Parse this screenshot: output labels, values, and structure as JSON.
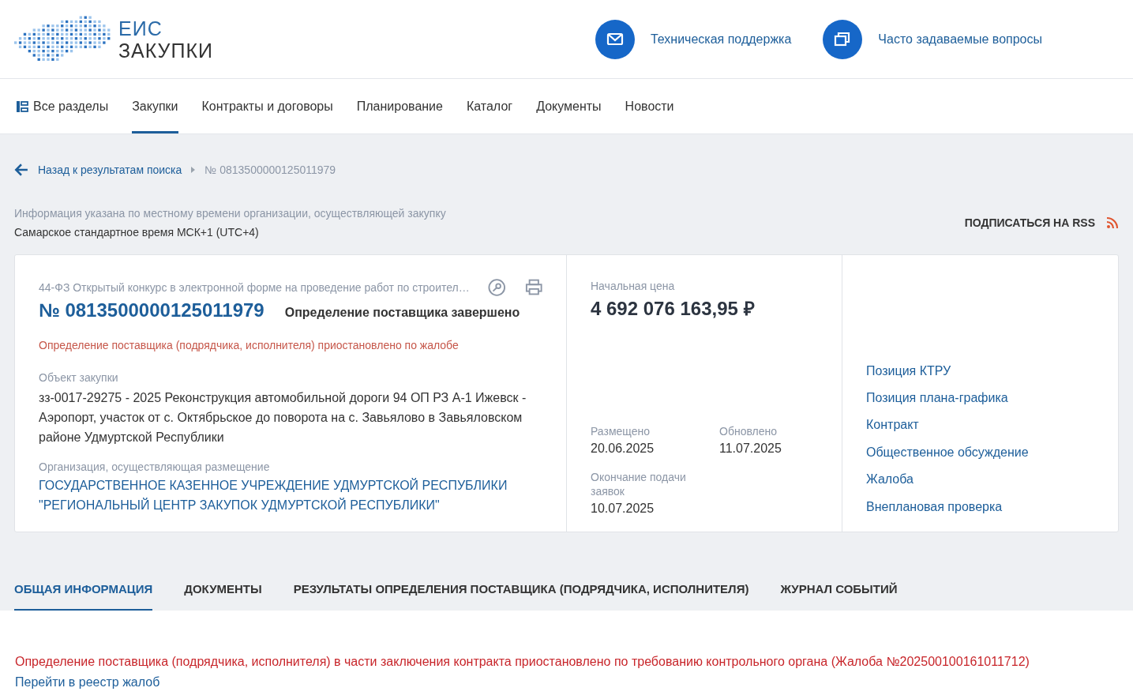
{
  "header": {
    "logo": {
      "line1": "ЕИС",
      "line2": "ЗАКУПКИ"
    },
    "links": [
      {
        "kind": "mail",
        "label": "Техническая поддержка"
      },
      {
        "kind": "windows",
        "label": "Часто задаваемые вопросы"
      }
    ]
  },
  "nav": [
    {
      "kind": "menu",
      "label": "Все разделы",
      "selected": false
    },
    {
      "kind": "link",
      "label": "Закупки",
      "selected": true
    },
    {
      "kind": "link",
      "label": "Контракты и договоры",
      "selected": false
    },
    {
      "kind": "link",
      "label": "Планирование",
      "selected": false
    },
    {
      "kind": "link",
      "label": "Каталог",
      "selected": false
    },
    {
      "kind": "link",
      "label": "Документы",
      "selected": false
    },
    {
      "kind": "link",
      "label": "Новости",
      "selected": false
    }
  ],
  "breadcrumb": {
    "back": "Назад к результатам поиска",
    "current": "№ 0813500000125011979"
  },
  "timezone": {
    "note": "Информация указана по местному времени организации, осуществляющей закупку",
    "value": "Самарское стандартное время МСК+1 (UTC+4)"
  },
  "rss": {
    "label": "ПОДПИСАТЬСЯ НА RSS"
  },
  "card": {
    "law": "44-ФЗ",
    "type": "Открытый конкурс в электронной форме на проведение работ по строител…",
    "number": "№ 0813500000125011979",
    "status": "Определение поставщика завершено",
    "warning": "Определение поставщика (подрядчика, исполнителя) приостановлено по жалобе",
    "object_label": "Объект закупки",
    "object": "зз-0017-29275 - 2025 Реконструкция автомобильной дороги 94 ОП РЗ А-1 Ижевск - Аэропорт, участок от с. Октябрьское до поворота на с. Завьялово в Завьяловском районе Удмуртской Республики",
    "org_label": "Организация, осуществляющая размещение",
    "org": "ГОСУДАРСТВЕННОЕ КАЗЕННОЕ УЧРЕЖДЕНИЕ УДМУРТСКОЙ РЕСПУБЛИКИ \"РЕГИОНАЛЬНЫЙ ЦЕНТР ЗАКУПОК УДМУРТСКОЙ РЕСПУБЛИКИ\"",
    "price_label": "Начальная цена",
    "price": "4 692 076 163,95 ₽",
    "dates": [
      {
        "label": "Размещено",
        "value": "20.06.2025"
      },
      {
        "label": "Обновлено",
        "value": "11.07.2025"
      },
      {
        "label": "Окончание подачи заявок",
        "value": "10.07.2025"
      }
    ],
    "links": [
      "Позиция КТРУ",
      "Позиция плана-графика",
      "Контракт",
      "Общественное обсуждение",
      "Жалоба",
      "Внеплановая проверка"
    ]
  },
  "tabs": [
    {
      "label": "ОБЩАЯ ИНФОРМАЦИЯ",
      "selected": true
    },
    {
      "label": "ДОКУМЕНТЫ",
      "selected": false
    },
    {
      "label": "РЕЗУЛЬТАТЫ ОПРЕДЕЛЕНИЯ ПОСТАВЩИКА (ПОДРЯДЧИКА, ИСПОЛНИТЕЛЯ)",
      "selected": false
    },
    {
      "label": "ЖУРНАЛ СОБЫТИЙ",
      "selected": false
    }
  ],
  "notice": {
    "text": "Определение поставщика (подрядчика, исполнителя) в части заключения контракта приостановлено по требованию контрольного органа (Жалоба №202500100161011712)",
    "link": "Перейти в реестр жалоб"
  }
}
